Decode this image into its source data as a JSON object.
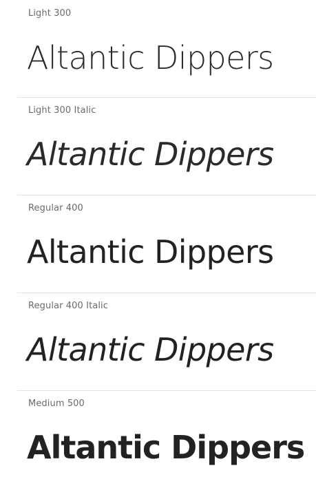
{
  "specimens": [
    {
      "label": "Light 300",
      "sample": "Altantic Dippers"
    },
    {
      "label": "Light 300 Italic",
      "sample": "Altantic Dippers"
    },
    {
      "label": "Regular 400",
      "sample": "Altantic Dippers"
    },
    {
      "label": "Regular 400 Italic",
      "sample": "Altantic Dippers"
    },
    {
      "label": "Medium 500",
      "sample": "Altantic Dippers"
    }
  ]
}
